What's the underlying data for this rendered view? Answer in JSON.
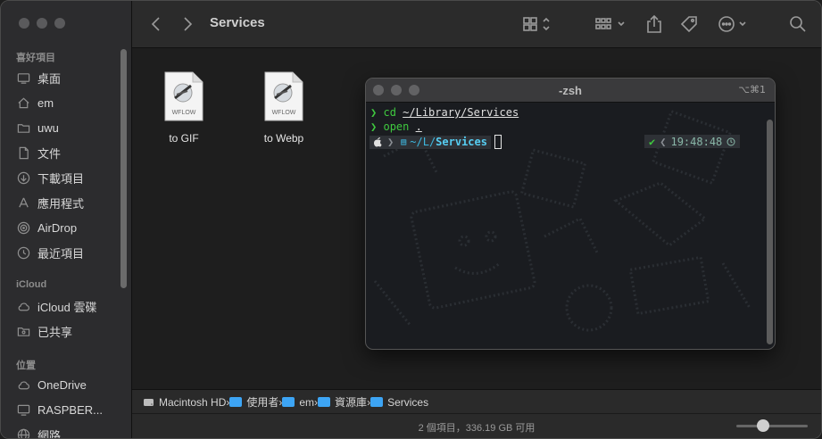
{
  "toolbar": {
    "title": "Services",
    "back_icon": "chevron-left-icon",
    "forward_icon": "chevron-right-icon"
  },
  "sidebar": {
    "sections": [
      {
        "title": "喜好項目",
        "items": [
          {
            "label": "桌面",
            "icon": "desktop-icon"
          },
          {
            "label": "em",
            "icon": "home-icon"
          },
          {
            "label": "uwu",
            "icon": "folder-icon"
          },
          {
            "label": "文件",
            "icon": "document-icon"
          },
          {
            "label": "下載項目",
            "icon": "download-icon"
          },
          {
            "label": "應用程式",
            "icon": "apps-icon"
          },
          {
            "label": "AirDrop",
            "icon": "airdrop-icon"
          },
          {
            "label": "最近項目",
            "icon": "clock-icon"
          }
        ]
      },
      {
        "title": "iCloud",
        "items": [
          {
            "label": "iCloud 雲碟",
            "icon": "cloud-icon"
          },
          {
            "label": "已共享",
            "icon": "shared-folder-icon"
          }
        ]
      },
      {
        "title": "位置",
        "items": [
          {
            "label": "OneDrive",
            "icon": "cloud-icon"
          },
          {
            "label": "RASPBER...",
            "icon": "display-icon"
          },
          {
            "label": "網路",
            "icon": "globe-icon"
          }
        ]
      }
    ]
  },
  "files": [
    {
      "name": "to GIF",
      "badge": "WFLOW"
    },
    {
      "name": "to Webp",
      "badge": "WFLOW"
    }
  ],
  "terminal": {
    "title": "-zsh",
    "shortcut": "⌥⌘1",
    "lines": [
      {
        "prompt": "❯",
        "cmd": "cd",
        "arg": "~/Library/Services"
      },
      {
        "prompt": "❯",
        "cmd": "open",
        "arg": "."
      }
    ],
    "p10k": {
      "path_prefix": "~/L/",
      "path_dir": "Services",
      "check": "✔",
      "time": "19:48:48"
    }
  },
  "pathbar": [
    {
      "label": "Macintosh HD",
      "icon": "disk-icon"
    },
    {
      "label": "使用者",
      "icon": "folder-icon"
    },
    {
      "label": "em",
      "icon": "home-folder-icon"
    },
    {
      "label": "資源庫",
      "icon": "folder-icon"
    },
    {
      "label": "Services",
      "icon": "folder-icon"
    }
  ],
  "status": {
    "text": "2 個項目，336.19 GB 可用",
    "zoom_level": 0.35
  },
  "colors": {
    "accent": "#3da5f5",
    "prompt": "#3fc93f",
    "p10k_path": "#3db8e0"
  }
}
